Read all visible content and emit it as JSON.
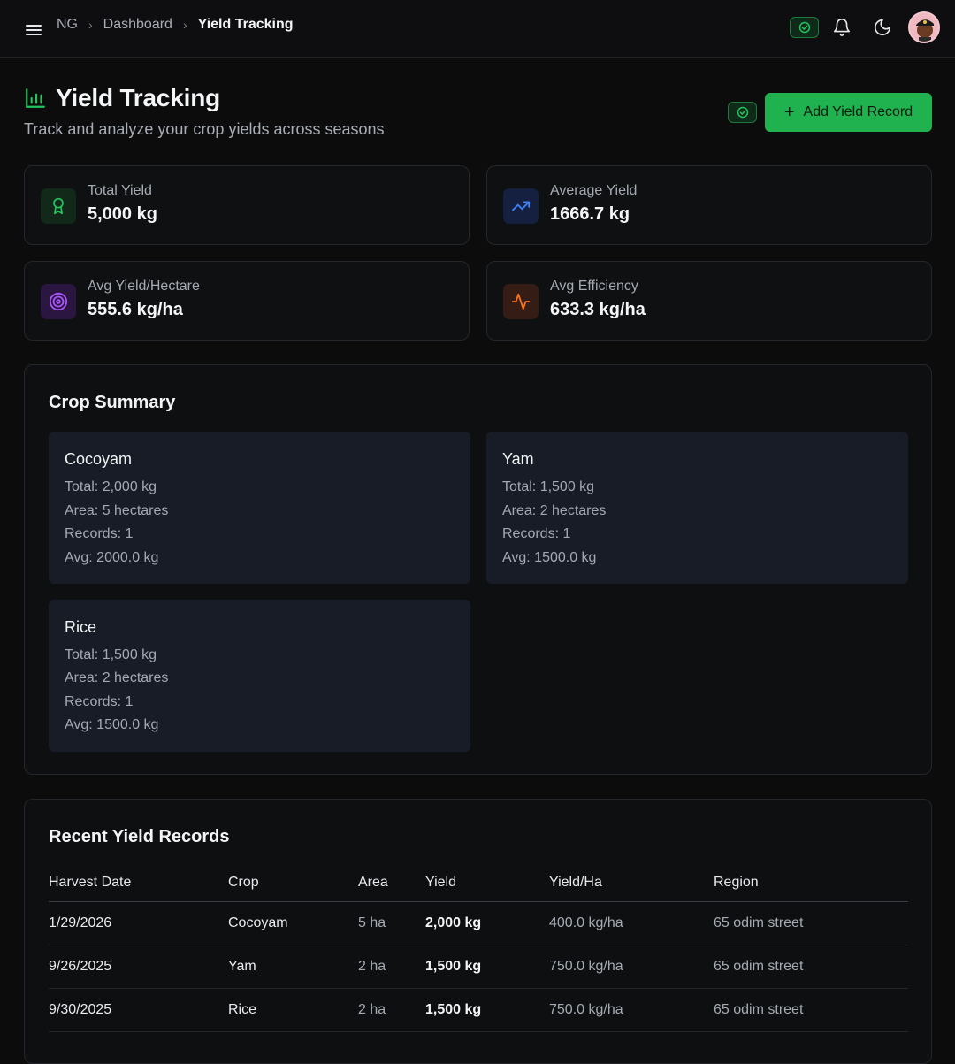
{
  "breadcrumb": {
    "root": "NG",
    "parent": "Dashboard",
    "current": "Yield Tracking"
  },
  "header": {
    "title": "Yield Tracking",
    "subtitle": "Track and analyze your crop yields across seasons",
    "add_button": "Add Yield Record"
  },
  "stats": [
    {
      "label": "Total Yield",
      "value": "5,000 kg",
      "icon": "award-icon",
      "color": "#22c55e"
    },
    {
      "label": "Average Yield",
      "value": "1666.7 kg",
      "icon": "trending-up-icon",
      "color": "#3b82f6"
    },
    {
      "label": "Avg Yield/Hectare",
      "value": "555.6 kg/ha",
      "icon": "target-icon",
      "color": "#a855f7"
    },
    {
      "label": "Avg Efficiency",
      "value": "633.3 kg/ha",
      "icon": "activity-icon",
      "color": "#f97316"
    }
  ],
  "crop_summary": {
    "title": "Crop Summary",
    "crops": [
      {
        "name": "Cocoyam",
        "total": "Total: 2,000 kg",
        "area": "Area: 5 hectares",
        "records": "Records: 1",
        "avg": "Avg: 2000.0 kg"
      },
      {
        "name": "Yam",
        "total": "Total: 1,500 kg",
        "area": "Area: 2 hectares",
        "records": "Records: 1",
        "avg": "Avg: 1500.0 kg"
      },
      {
        "name": "Rice",
        "total": "Total: 1,500 kg",
        "area": "Area: 2 hectares",
        "records": "Records: 1",
        "avg": "Avg: 1500.0 kg"
      }
    ]
  },
  "records": {
    "title": "Recent Yield Records",
    "columns": [
      "Harvest Date",
      "Crop",
      "Area",
      "Yield",
      "Yield/Ha",
      "Region"
    ],
    "rows": [
      [
        "1/29/2026",
        "Cocoyam",
        "5 ha",
        "2,000 kg",
        "400.0 kg/ha",
        "65 odim street"
      ],
      [
        "9/26/2025",
        "Yam",
        "2 ha",
        "1,500 kg",
        "750.0 kg/ha",
        "65 odim street"
      ],
      [
        "9/30/2025",
        "Rice",
        "2 ha",
        "1,500 kg",
        "750.0 kg/ha",
        "65 odim street"
      ]
    ]
  },
  "colors": {
    "accent": "#1fb24f",
    "background": "#0c0c0d",
    "card": "#181c27"
  }
}
